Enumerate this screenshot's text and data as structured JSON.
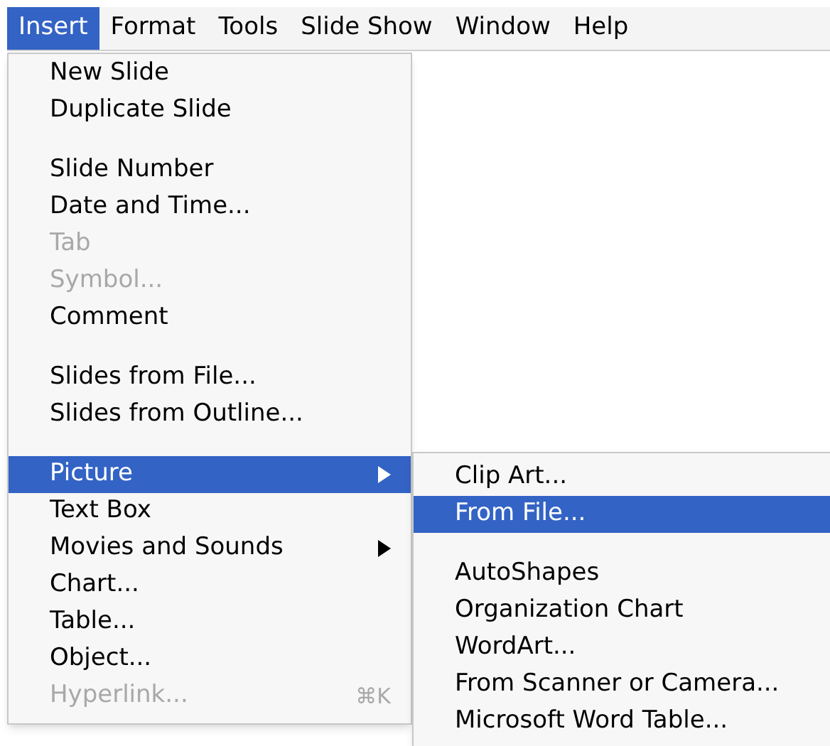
{
  "menu_bar": [
    {
      "label": "Insert",
      "selected": true
    },
    {
      "label": "Format",
      "selected": false
    },
    {
      "label": "Tools",
      "selected": false
    },
    {
      "label": "Slide Show",
      "selected": false
    },
    {
      "label": "Window",
      "selected": false
    },
    {
      "label": "Help",
      "selected": false
    }
  ],
  "menu": {
    "items": [
      {
        "kind": "item",
        "label": "New Slide",
        "disabled": false,
        "selected": false
      },
      {
        "kind": "item",
        "label": "Duplicate Slide",
        "disabled": false,
        "selected": false
      },
      {
        "kind": "separator"
      },
      {
        "kind": "item",
        "label": "Slide Number",
        "disabled": false,
        "selected": false
      },
      {
        "kind": "item",
        "label": "Date and Time...",
        "disabled": false,
        "selected": false
      },
      {
        "kind": "item",
        "label": "Tab",
        "disabled": true,
        "selected": false
      },
      {
        "kind": "item",
        "label": "Symbol...",
        "disabled": true,
        "selected": false
      },
      {
        "kind": "item",
        "label": "Comment",
        "disabled": false,
        "selected": false
      },
      {
        "kind": "separator"
      },
      {
        "kind": "item",
        "label": "Slides from File...",
        "disabled": false,
        "selected": false
      },
      {
        "kind": "item",
        "label": "Slides from Outline...",
        "disabled": false,
        "selected": false
      },
      {
        "kind": "separator"
      },
      {
        "kind": "submenu",
        "label": "Picture",
        "disabled": false,
        "selected": true
      },
      {
        "kind": "item",
        "label": "Text Box",
        "disabled": false,
        "selected": false
      },
      {
        "kind": "submenu",
        "label": "Movies and Sounds",
        "disabled": false,
        "selected": false
      },
      {
        "kind": "item",
        "label": "Chart...",
        "disabled": false,
        "selected": false
      },
      {
        "kind": "item",
        "label": "Table...",
        "disabled": false,
        "selected": false
      },
      {
        "kind": "item",
        "label": "Object...",
        "disabled": false,
        "selected": false
      },
      {
        "kind": "item",
        "label": "Hyperlink...",
        "disabled": true,
        "selected": false,
        "shortcut": "⌘K"
      }
    ]
  },
  "submenu": {
    "items": [
      {
        "kind": "item",
        "label": "Clip Art...",
        "selected": false
      },
      {
        "kind": "item",
        "label": "From File...",
        "selected": true
      },
      {
        "kind": "separator"
      },
      {
        "kind": "item",
        "label": "AutoShapes",
        "selected": false
      },
      {
        "kind": "item",
        "label": "Organization Chart",
        "selected": false
      },
      {
        "kind": "item",
        "label": "WordArt...",
        "selected": false
      },
      {
        "kind": "item",
        "label": "From Scanner or Camera...",
        "selected": false
      },
      {
        "kind": "item",
        "label": "Microsoft Word Table...",
        "selected": false
      }
    ]
  }
}
